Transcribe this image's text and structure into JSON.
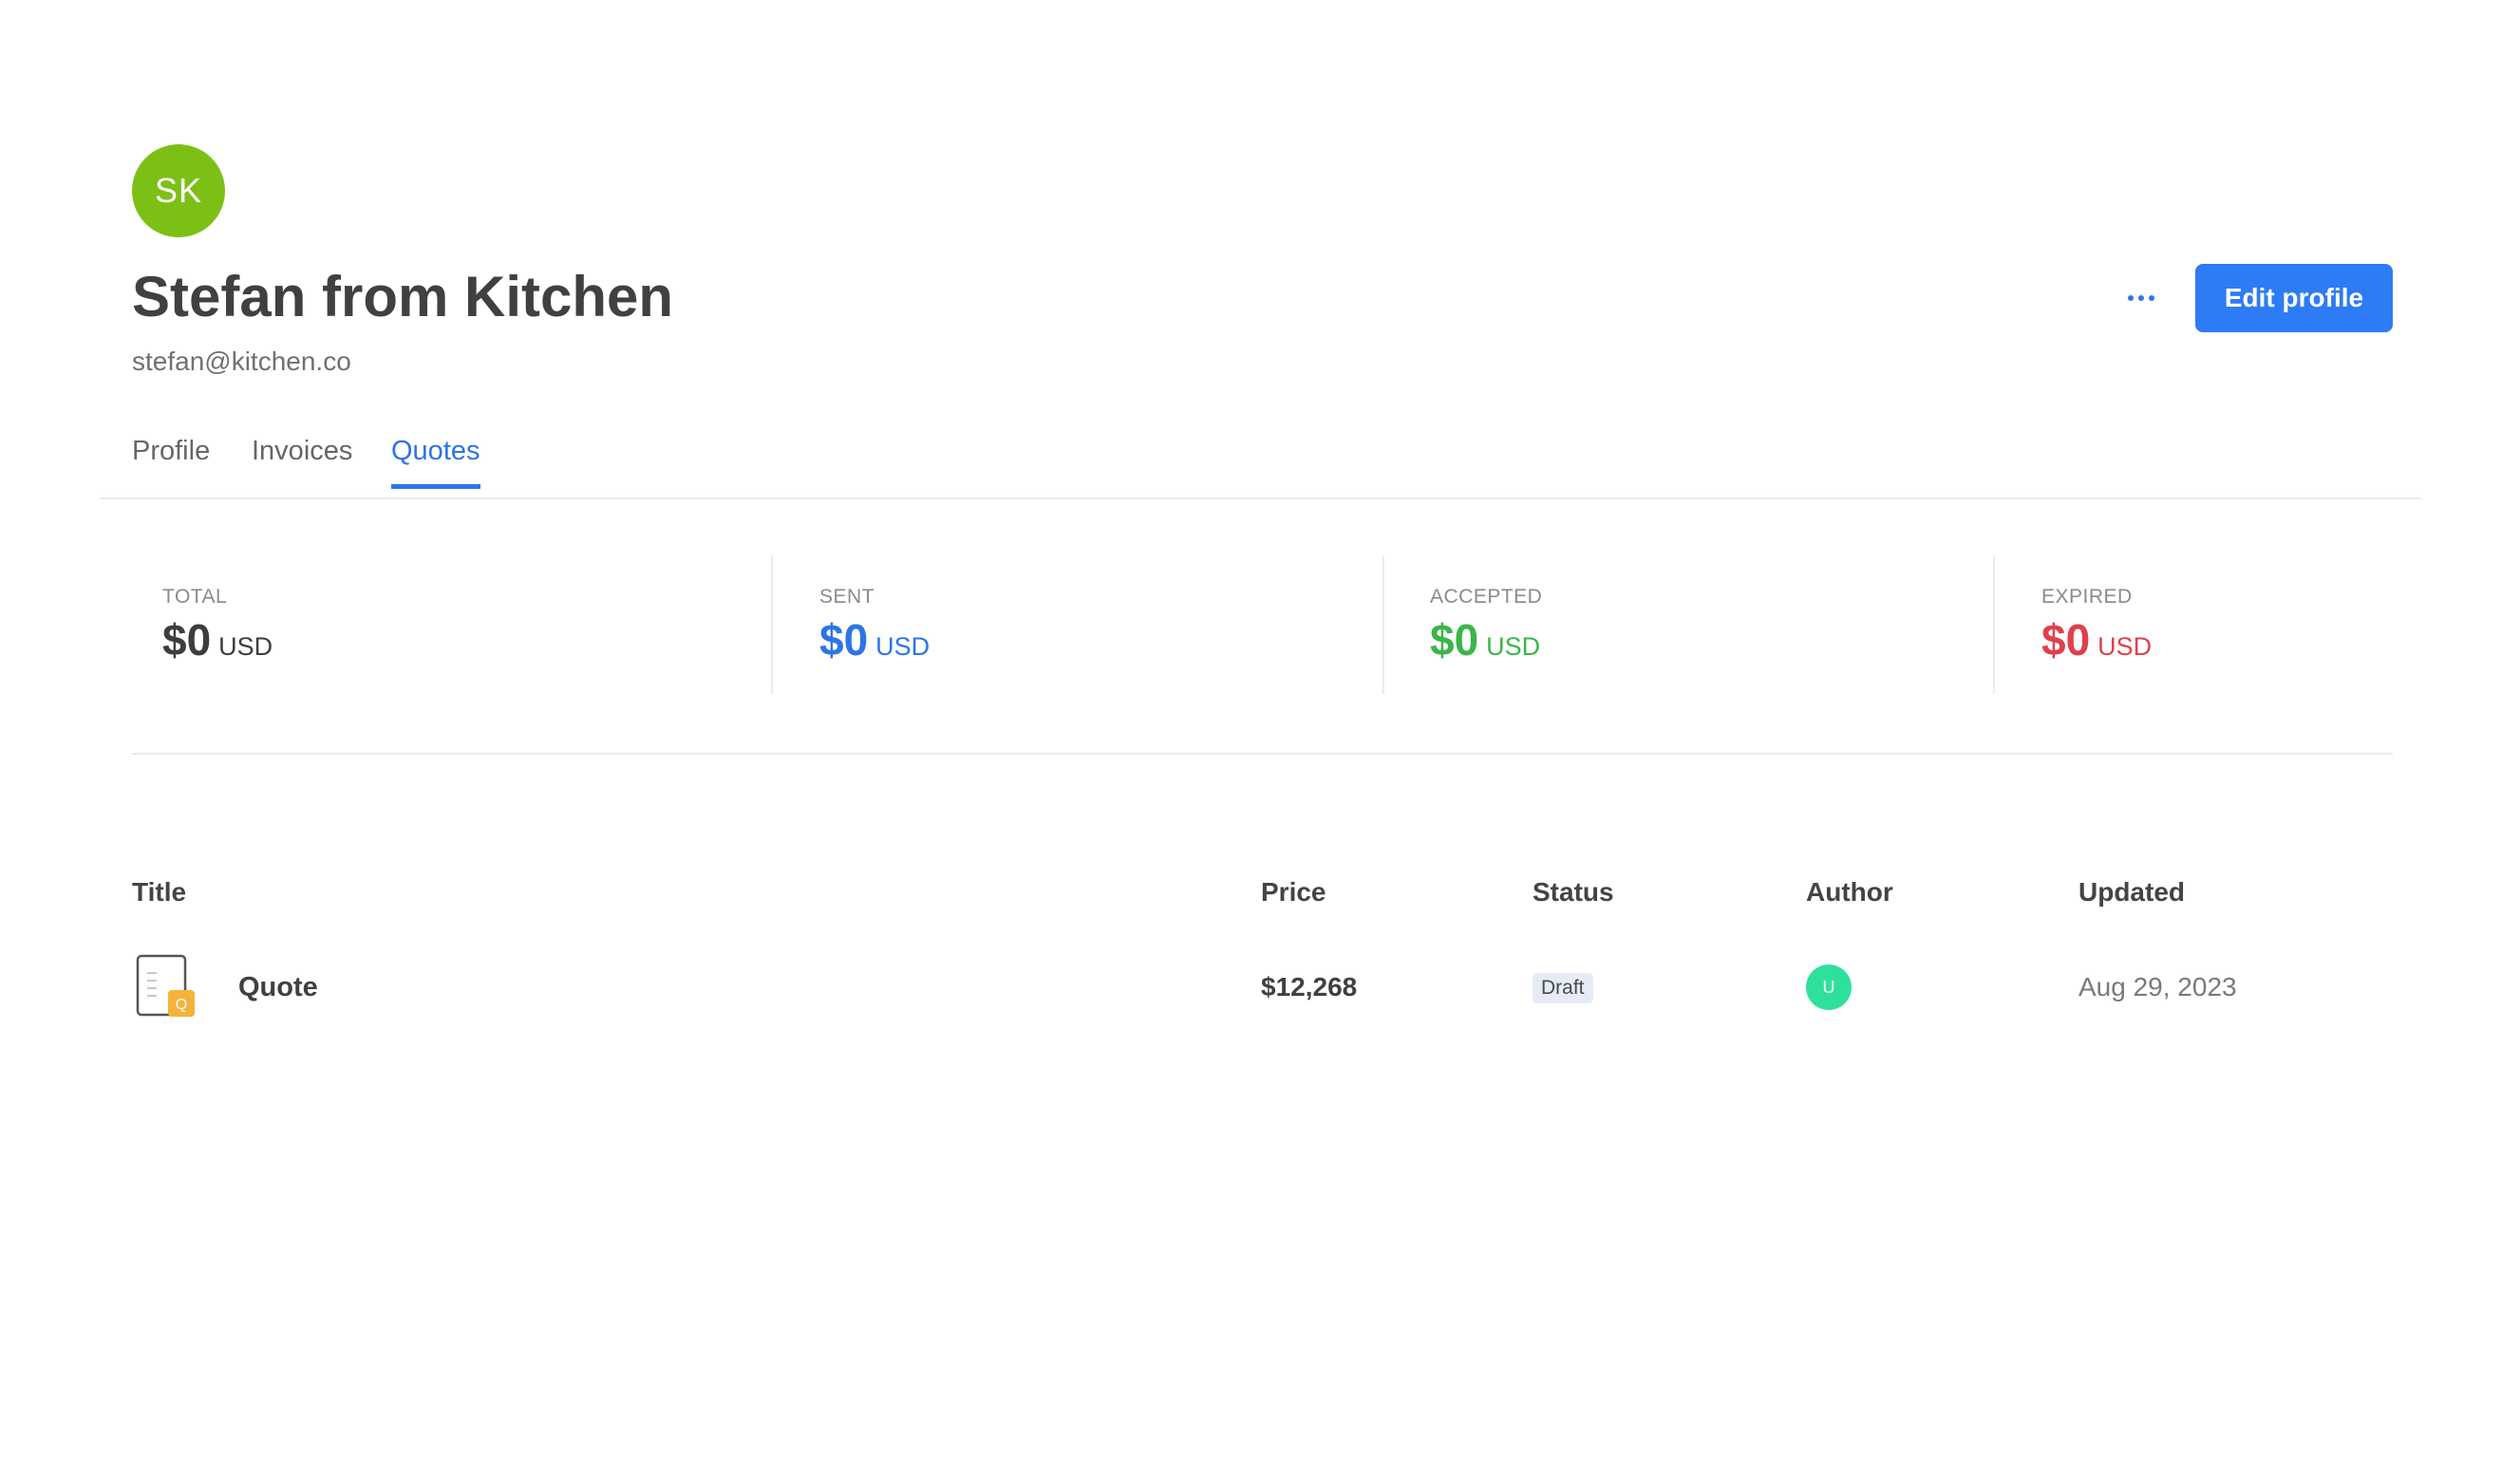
{
  "profile": {
    "initials": "SK",
    "name": "Stefan from Kitchen",
    "email": "stefan@kitchen.co",
    "avatar_color": "#7cc016"
  },
  "actions": {
    "more_icon": "more-horizontal-icon",
    "edit_label": "Edit profile",
    "accent_color": "#2e7bf6"
  },
  "tabs": [
    {
      "label": "Profile",
      "active": false
    },
    {
      "label": "Invoices",
      "active": false
    },
    {
      "label": "Quotes",
      "active": true
    }
  ],
  "stats": [
    {
      "label": "TOTAL",
      "amount": "$0",
      "unit": "USD",
      "color": "#3d3d3d"
    },
    {
      "label": "SENT",
      "amount": "$0",
      "unit": "USD",
      "color": "#2e74e6"
    },
    {
      "label": "ACCEPTED",
      "amount": "$0",
      "unit": "USD",
      "color": "#3bb54a"
    },
    {
      "label": "EXPIRED",
      "amount": "$0",
      "unit": "USD",
      "color": "#e0404b"
    }
  ],
  "table": {
    "headers": {
      "title": "Title",
      "price": "Price",
      "status": "Status",
      "author": "Author",
      "updated": "Updated"
    },
    "rows": [
      {
        "icon": "quote-document-icon",
        "icon_badge": "Q",
        "title": "Quote",
        "price": "$12,268",
        "status": "Draft",
        "author_initial": "U",
        "author_color": "#2fe09c",
        "updated": "Aug 29, 2023"
      }
    ]
  }
}
